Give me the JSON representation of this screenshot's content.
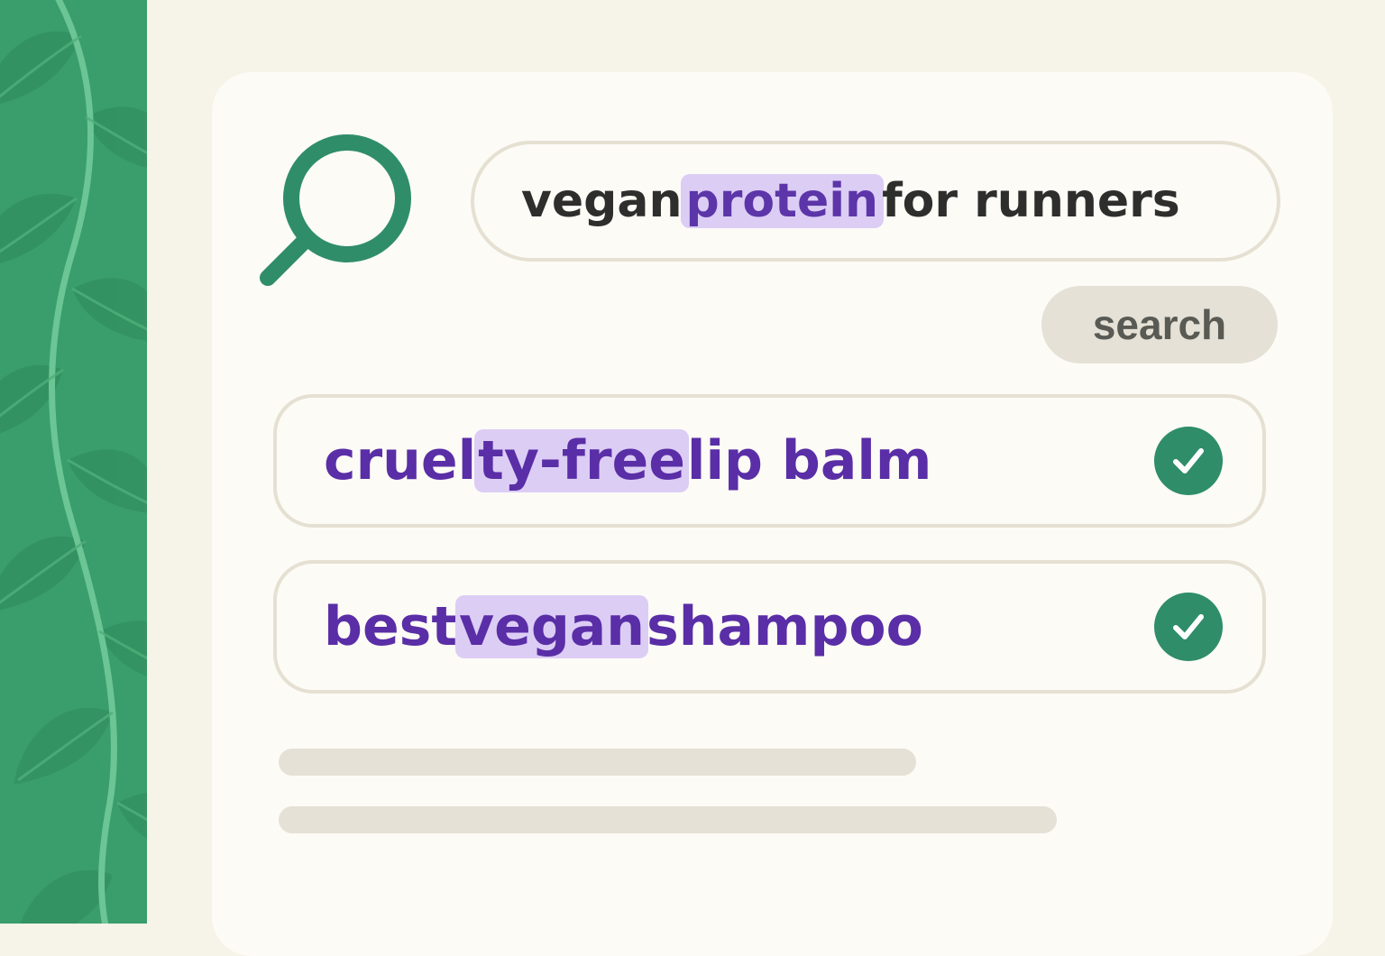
{
  "colors": {
    "accent_green": "#2f8d6a",
    "leaf_panel": "#3a9e6c",
    "highlight": "#dccdf5",
    "result_text": "#5a2ea6",
    "background": "#f6f3e8"
  },
  "search": {
    "query_parts": [
      {
        "text": "vegan ",
        "highlight": false
      },
      {
        "text": "protein",
        "highlight": true
      },
      {
        "text": " for runners",
        "highlight": false
      }
    ],
    "button_label": "search",
    "icon": "search-icon"
  },
  "results": [
    {
      "parts": [
        {
          "text": "cruel",
          "highlight": false
        },
        {
          "text": "ty-free",
          "highlight": true
        },
        {
          "text": " lip balm",
          "highlight": false
        }
      ],
      "status_icon": "check-circle-icon",
      "checked": true
    },
    {
      "parts": [
        {
          "text": "best ",
          "highlight": false
        },
        {
          "text": "vegan",
          "highlight": true
        },
        {
          "text": " shampoo",
          "highlight": false
        }
      ],
      "status_icon": "check-circle-icon",
      "checked": true
    }
  ]
}
